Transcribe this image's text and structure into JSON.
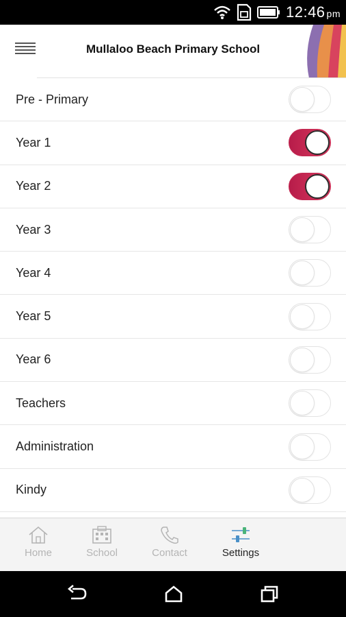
{
  "status_bar": {
    "time": "12:46",
    "ampm": "pm"
  },
  "header": {
    "title": "Mullaloo Beach Primary School"
  },
  "settings": [
    {
      "label": "Pre - Primary",
      "on": false
    },
    {
      "label": "Year 1",
      "on": true
    },
    {
      "label": "Year 2",
      "on": true
    },
    {
      "label": "Year 3",
      "on": false
    },
    {
      "label": "Year 4",
      "on": false
    },
    {
      "label": "Year 5",
      "on": false
    },
    {
      "label": "Year 6",
      "on": false
    },
    {
      "label": "Teachers",
      "on": false
    },
    {
      "label": "Administration",
      "on": false
    },
    {
      "label": "Kindy",
      "on": false
    }
  ],
  "tabs": [
    {
      "label": "Home",
      "icon": "home-icon",
      "active": false
    },
    {
      "label": "School",
      "icon": "school-icon",
      "active": false
    },
    {
      "label": "Contact",
      "icon": "phone-icon",
      "active": false
    },
    {
      "label": "Settings",
      "icon": "sliders-icon",
      "active": true
    }
  ],
  "colors": {
    "toggle_on": "#c42a52",
    "tab_active": "#222222",
    "tab_inactive": "#b4b4b4"
  }
}
